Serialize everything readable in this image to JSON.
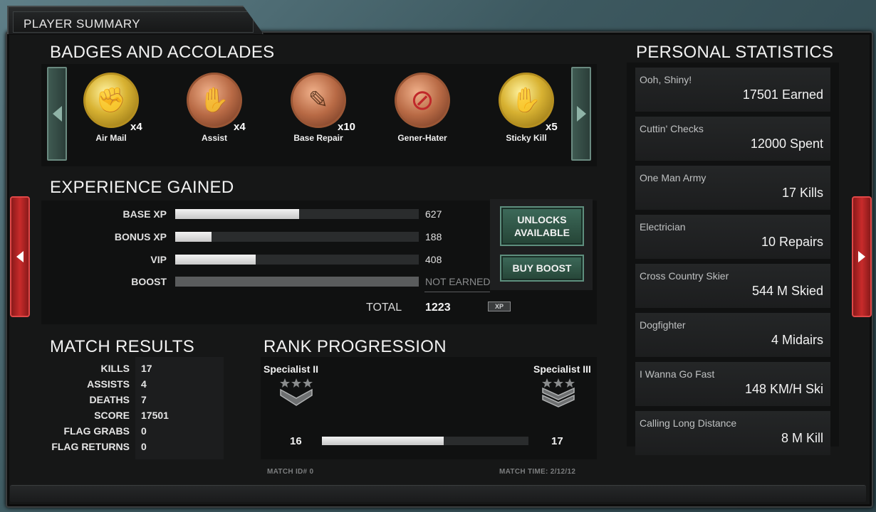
{
  "header": {
    "title": "PLAYER SUMMARY"
  },
  "badges": {
    "title": "BADGES AND ACCOLADES",
    "items": [
      {
        "label": "Air Mail",
        "count": "x4",
        "style": "gold",
        "icon": "fist-icon"
      },
      {
        "label": "Assist",
        "count": "x4",
        "style": "bronze",
        "icon": "handshake-icon"
      },
      {
        "label": "Base Repair",
        "count": "x10",
        "style": "bronze",
        "icon": "wrench-icon"
      },
      {
        "label": "Gener-Hater",
        "count": "",
        "style": "bronze",
        "icon": "no-generator-icon"
      },
      {
        "label": "Sticky Kill",
        "count": "x5",
        "style": "gold",
        "icon": "sticky-hand-icon"
      }
    ]
  },
  "experience": {
    "title": "EXPERIENCE GAINED",
    "rows": [
      {
        "label": "BASE XP",
        "value": "627",
        "fill": 0.51
      },
      {
        "label": "BONUS XP",
        "value": "188",
        "fill": 0.15
      },
      {
        "label": "VIP",
        "value": "408",
        "fill": 0.33
      },
      {
        "label": "BOOST",
        "value": "NOT EARNED",
        "fill": 1.0
      }
    ],
    "total_label": "TOTAL",
    "total_value": "1223",
    "xp_badge": "XP",
    "unlocks_button": "UNLOCKS AVAILABLE",
    "buy_boost_button": "BUY BOOST"
  },
  "match_results": {
    "title": "MATCH RESULTS",
    "rows": [
      {
        "label": "KILLS",
        "value": "17"
      },
      {
        "label": "ASSISTS",
        "value": "4"
      },
      {
        "label": "DEATHS",
        "value": "7"
      },
      {
        "label": "SCORE",
        "value": "17501"
      },
      {
        "label": "FLAG GRABS",
        "value": "0"
      },
      {
        "label": "FLAG RETURNS",
        "value": "0"
      }
    ]
  },
  "rank": {
    "title": "RANK PROGRESSION",
    "current": "Specialist II",
    "next": "Specialist III",
    "current_level": "16",
    "next_level": "17",
    "progress": 0.59
  },
  "meta": {
    "match_id": "MATCH ID# 0",
    "match_time": "MATCH TIME: 2/12/12"
  },
  "personal_stats": {
    "title": "PERSONAL STATISTICS",
    "items": [
      {
        "name": "Ooh, Shiny!",
        "value": "17501 Earned"
      },
      {
        "name": "Cuttin' Checks",
        "value": "12000 Spent"
      },
      {
        "name": "One Man Army",
        "value": "17 Kills"
      },
      {
        "name": "Electrician",
        "value": "10 Repairs"
      },
      {
        "name": "Cross Country Skier",
        "value": "544 M Skied"
      },
      {
        "name": "Dogfighter",
        "value": "4 Midairs"
      },
      {
        "name": "I Wanna Go Fast",
        "value": "148 KM/H Ski"
      },
      {
        "name": "Calling Long Distance",
        "value": "8 M Kill"
      }
    ]
  },
  "colors": {
    "accent_green": "#3d6a5a",
    "accent_red": "#c82b2b",
    "gold": "#d8b232",
    "bronze": "#b86a45"
  }
}
